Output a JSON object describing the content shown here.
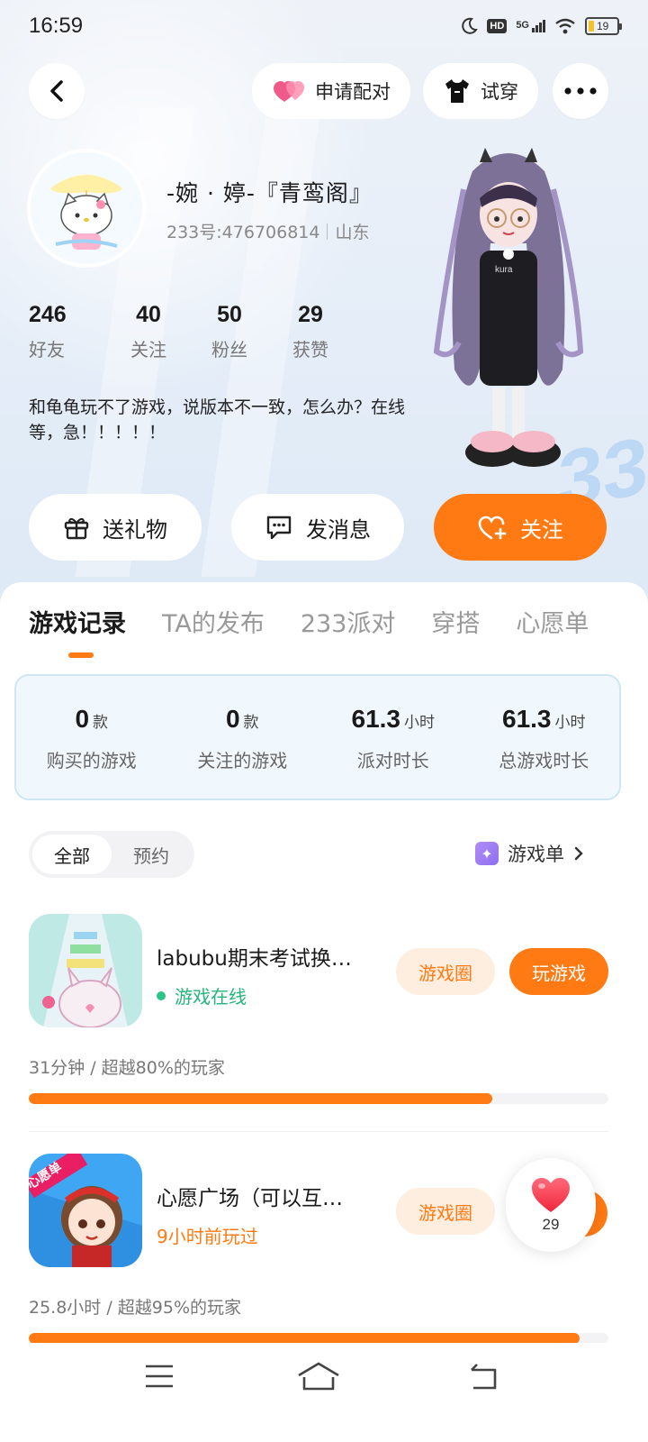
{
  "status_bar": {
    "time": "16:59",
    "hd": "HD",
    "network": "5G",
    "battery": "19",
    "battery_level": 0.19
  },
  "header": {
    "pair_label": "申请配对",
    "tryon_label": "试穿"
  },
  "profile": {
    "nickname": "-婉 · 婷-『青鸾阁』",
    "uid": "233号:476706814",
    "region": "山东",
    "bio": "和龟龟玩不了游戏，说版本不一致，怎么办？在线等，急！！！！！",
    "stats": [
      {
        "value": "246",
        "label": "好友"
      },
      {
        "value": "40",
        "label": "关注"
      },
      {
        "value": "50",
        "label": "粉丝"
      },
      {
        "value": "29",
        "label": "获赞"
      }
    ]
  },
  "actions": {
    "gift": "送礼物",
    "message": "发消息",
    "follow": "关注"
  },
  "tabs": [
    "游戏记录",
    "TA的发布",
    "233派对",
    "穿搭",
    "心愿单"
  ],
  "summary": [
    {
      "value": "0",
      "unit": "款",
      "label": "购买的游戏"
    },
    {
      "value": "0",
      "unit": "款",
      "label": "关注的游戏"
    },
    {
      "value": "61.3",
      "unit": "小时",
      "label": "派对时长"
    },
    {
      "value": "61.3",
      "unit": "小时",
      "label": "总游戏时长"
    }
  ],
  "filter": {
    "options": [
      "全部",
      "预约"
    ],
    "selected": "全部",
    "gamelist_label": "游戏单"
  },
  "games": [
    {
      "name": "labubu期末考试换…",
      "status": "游戏在线",
      "circle_label": "游戏圈",
      "play_label": "玩游戏",
      "playtime": "31分钟 / 超越80%的玩家",
      "progress": 0.8
    },
    {
      "name": "心愿广场（可以互…",
      "status": "9小时前玩过",
      "circle_label": "游戏圈",
      "icon_badge": "心愿单",
      "playtime": "25.8小时 / 超越95%的玩家",
      "progress": 0.95
    }
  ],
  "like_bubble": {
    "count": "29"
  },
  "colors": {
    "accent": "#ff7a12",
    "online": "#25b57a",
    "summary_bg": "#f1f8fd"
  }
}
